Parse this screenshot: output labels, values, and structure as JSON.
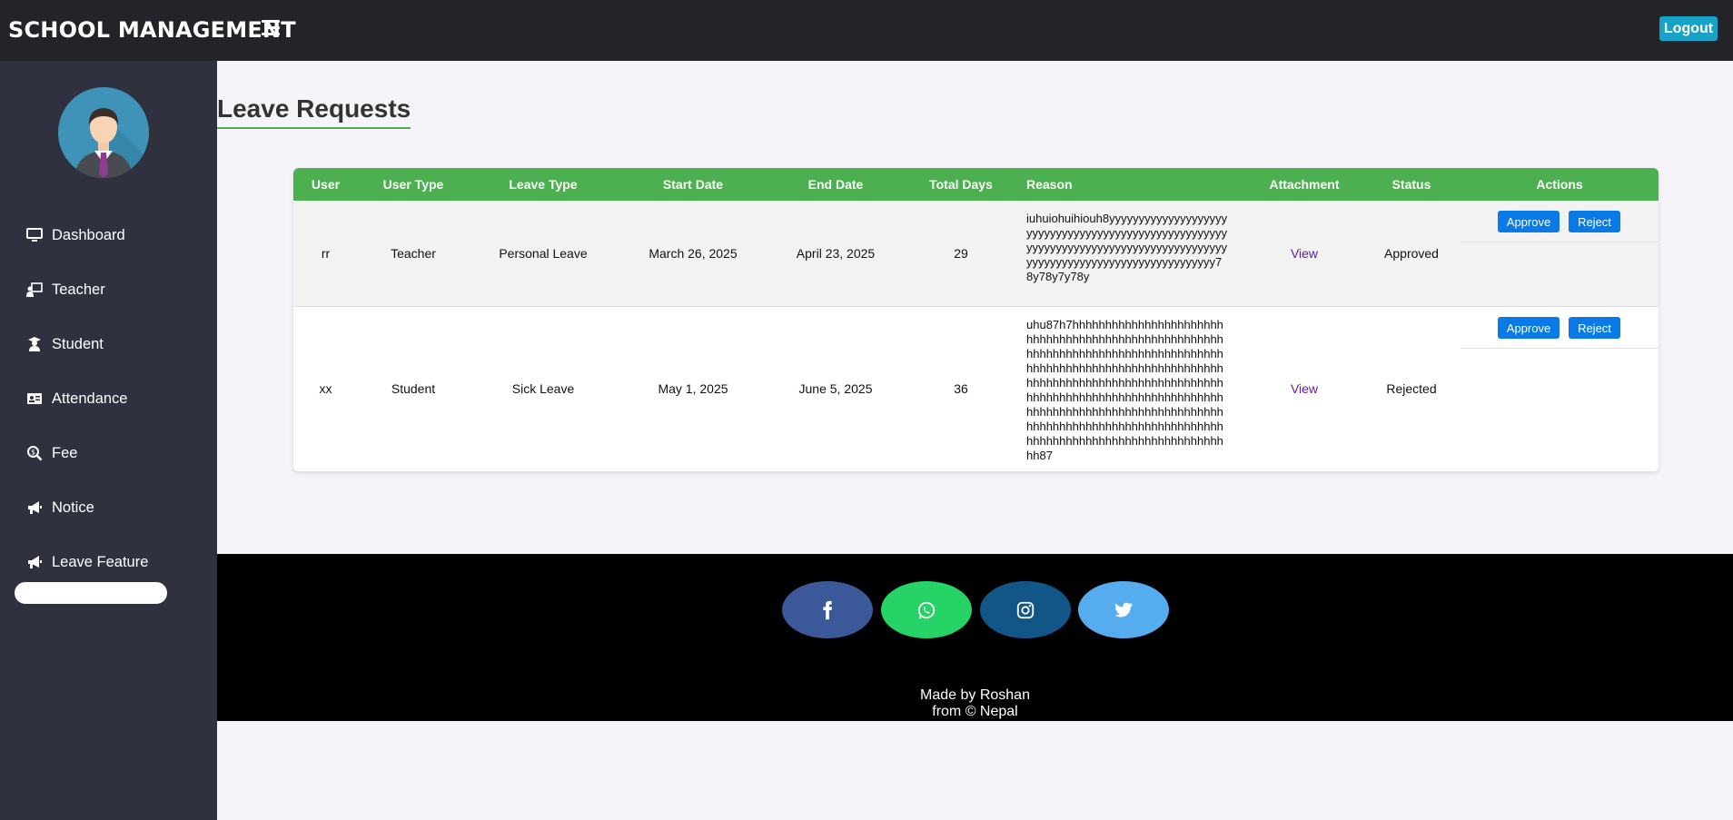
{
  "header": {
    "brand": "SCHOOL MANAGEMENT",
    "logout_label": "Logout"
  },
  "sidebar": {
    "items": [
      {
        "label": "Dashboard",
        "icon": "monitor-icon"
      },
      {
        "label": "Teacher",
        "icon": "teacher-icon"
      },
      {
        "label": "Student",
        "icon": "student-icon"
      },
      {
        "label": "Attendance",
        "icon": "id-card-icon"
      },
      {
        "label": "Fee",
        "icon": "search-dollar-icon"
      },
      {
        "label": "Notice",
        "icon": "megaphone-icon"
      },
      {
        "label": "Leave Feature",
        "icon": "megaphone-icon"
      }
    ]
  },
  "main": {
    "title": "Leave Requests",
    "table": {
      "headers": [
        "User",
        "User Type",
        "Leave Type",
        "Start Date",
        "End Date",
        "Total Days",
        "Reason",
        "Attachment",
        "Status",
        "Actions"
      ],
      "rows": [
        {
          "user": "rr",
          "user_type": "Teacher",
          "leave_type": "Personal Leave",
          "start_date": "March 26, 2025",
          "end_date": "April 23, 2025",
          "total_days": "29",
          "reason": "iuhuiohuihiouh8yyyyyyyyyyyyyyyyyyyyyyyyyyyyyyyyyyyyyyyyyyyyyyyyyyyyyyyyyyyyyyyyyyyyyyyyyyyyyyyyyyyyyyyyyyyyyyyyyyyyyyyyyyyyyyyyyyyyyyyy78y78y7y78y",
          "attachment": "View",
          "status": "Approved",
          "approve": "Approve",
          "reject": "Reject"
        },
        {
          "user": "xx",
          "user_type": "Student",
          "leave_type": "Sick Leave",
          "start_date": "May 1, 2025",
          "end_date": "June 5, 2025",
          "total_days": "36",
          "reason": "uhu87h7hhhhhhhhhhhhhhhhhhhhhhhhhhhhhhhhhhhhhhhhhhhhhhhhhhhhhhhhhhhhhhhhhhhhhhhhhhhhhhhhhhhhhhhhhhhhhhhhhhhhhhhhhhhhhhhhhhhhhhhhhhhhhhhhhhhhhhhhhhhhhhhhhhhhhhhhhhhhhhhhhhhhhhhhhhhhhhhhhhhhhhhhhhhhhhhhhhhhhhhhhhhhhhhhhhhhhhhhhhhhhhhhhhhhhhhhhhhhhhhhhhhhhhhhhhhhhhhhhhhhhhhhh87",
          "attachment": "View",
          "status": "Rejected",
          "approve": "Approve",
          "reject": "Reject"
        }
      ]
    }
  },
  "footer": {
    "social": [
      {
        "name": "facebook",
        "color": "#3b5998"
      },
      {
        "name": "whatsapp",
        "color": "#25d366"
      },
      {
        "name": "instagram",
        "color": "#125688"
      },
      {
        "name": "twitter",
        "color": "#55acee"
      }
    ],
    "credit_line1": "Made by Roshan",
    "credit_line2": "from © Nepal"
  },
  "colors": {
    "topbar": "#23242a",
    "sidebar": "#2f323e",
    "table_header": "#4caf50",
    "primary_button": "#0a7be6",
    "logout_button": "#17a2c8"
  }
}
